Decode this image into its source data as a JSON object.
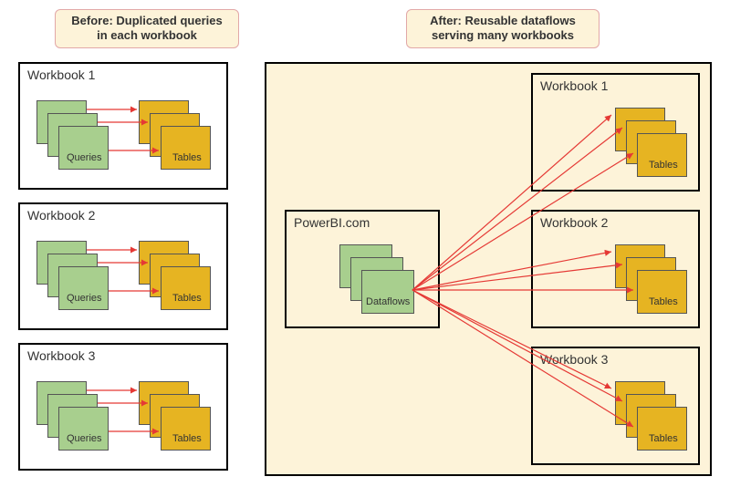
{
  "before": {
    "caption": "Before: Duplicated queries in each workbook",
    "workbooks": [
      {
        "title": "Workbook 1",
        "left_label": "Queries",
        "right_label": "Tables"
      },
      {
        "title": "Workbook 2",
        "left_label": "Queries",
        "right_label": "Tables"
      },
      {
        "title": "Workbook 3",
        "left_label": "Queries",
        "right_label": "Tables"
      }
    ]
  },
  "after": {
    "caption": "After: Reusable dataflows serving many workbooks",
    "source": {
      "title": "PowerBI.com",
      "stack_label": "Dataflows"
    },
    "workbooks": [
      {
        "title": "Workbook 1",
        "right_label": "Tables"
      },
      {
        "title": "Workbook 2",
        "right_label": "Tables"
      },
      {
        "title": "Workbook 3",
        "right_label": "Tables"
      }
    ]
  }
}
